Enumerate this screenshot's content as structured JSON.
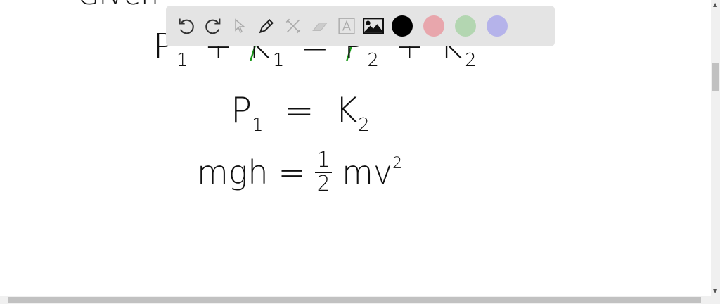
{
  "canvas": {
    "line0": "Given",
    "line1": {
      "a": "P",
      "a_sub": "1",
      "plus1": "+",
      "b": "K",
      "b_sub": "1",
      "eq": "=",
      "c": "P",
      "c_sub": "2",
      "plus2": "+",
      "d": "K",
      "d_sub": "2"
    },
    "line2": {
      "a": "P",
      "a_sub": "1",
      "eq": "=",
      "b": "K",
      "b_sub": "2"
    },
    "line3": {
      "lhs": "mgh",
      "eq": "=",
      "num": "1",
      "den": "2",
      "rhs": "mv",
      "sup": "2"
    }
  },
  "toolbar": {
    "tools": [
      "undo-icon",
      "redo-icon",
      "select-icon",
      "pen-icon",
      "tools-icon",
      "eraser-icon",
      "text-icon",
      "image-icon"
    ],
    "colors": [
      "#000000",
      "#e8a6ac",
      "#b3d6b1",
      "#b5b3ea"
    ]
  }
}
